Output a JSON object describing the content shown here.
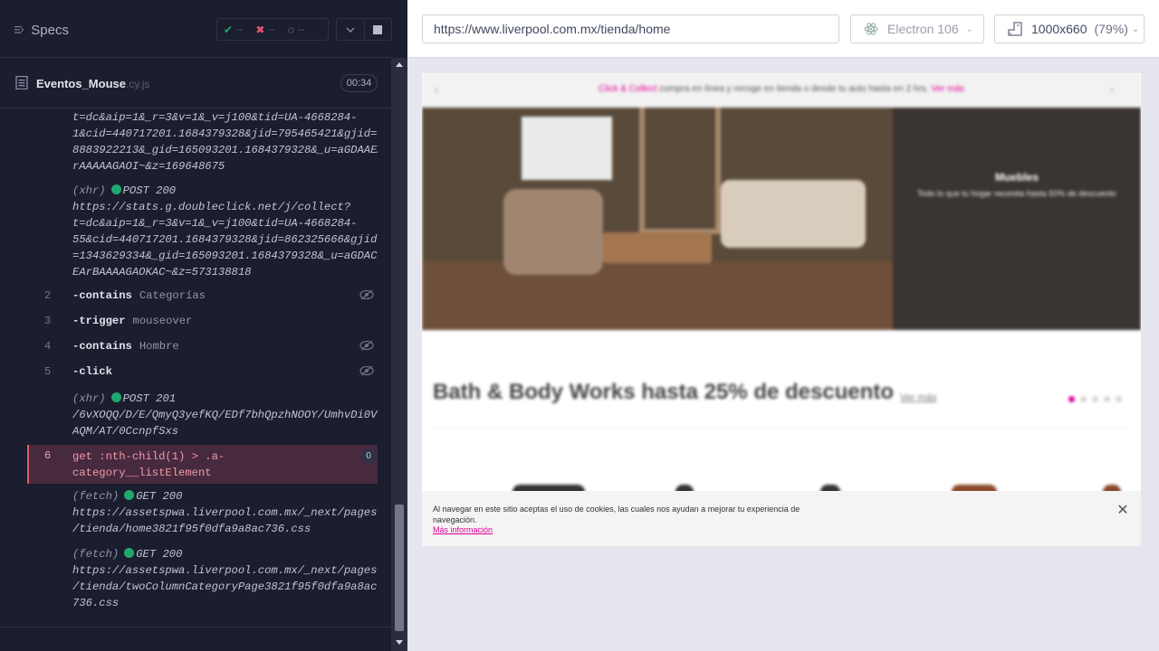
{
  "reporter": {
    "header": {
      "specs_label": "Specs",
      "stats": {
        "passed": "--",
        "failed": "--",
        "pending": "--"
      }
    },
    "runnable": {
      "spec_name": "Eventos_Mouse",
      "spec_ext": ".cy.js",
      "duration": "00:34"
    },
    "log": {
      "xhr_top_lines": [
        "t=dc&aip=1&_r=3&v=1&_v=j100&tid=UA-4668284-",
        "1&cid=440717201.1684379328&jid=795465421&gjid=",
        "8883922213&_gid=165093201.1684379328&_u=aGDAAEA",
        "rAAAAAGAOI~&z=169648675"
      ],
      "xhr_2": {
        "kind": "(xhr)",
        "method": "POST 200",
        "lines": [
          "https://stats.g.doubleclick.net/j/collect?",
          "t=dc&aip=1&_r=3&v=1&_v=j100&tid=UA-4668284-",
          "55&cid=440717201.1684379328&jid=862325666&gjid",
          "=1343629334&_gid=165093201.1684379328&_u=aGDAC",
          "EArBAAAAGAOKAC~&z=573138818"
        ]
      },
      "commands": [
        {
          "num": "2",
          "name": "-contains",
          "arg": "Categorías"
        },
        {
          "num": "3",
          "name": "-trigger",
          "arg": "mouseover"
        },
        {
          "num": "4",
          "name": "-contains",
          "arg": "Hombre"
        },
        {
          "num": "5",
          "name": "-click",
          "arg": ""
        }
      ],
      "xhr_3": {
        "kind": "(xhr)",
        "method": "POST 201",
        "lines": [
          "/6vXOQQ/D/E/QmyQ3yefKQ/EDf7bhQpzhNOOY/UmhvDi0V",
          "AQM/AT/0CcnpfSxs"
        ]
      },
      "active": {
        "num": "6",
        "lines": [
          "get  :nth-child(1) > .a-",
          "category__listElement"
        ],
        "badge": "0"
      },
      "fetch_1": {
        "kind": "(fetch)",
        "method": "GET 200",
        "lines": [
          "https://assetspwa.liverpool.com.mx/_next/pages",
          "/tienda/home3821f95f0dfa9a8ac736.css"
        ]
      },
      "fetch_2": {
        "kind": "(fetch)",
        "method": "GET 200",
        "lines": [
          "https://assetspwa.liverpool.com.mx/_next/pages",
          "/tienda/twoColumnCategoryPage3821f95f0dfa9a8ac",
          "736.css"
        ]
      }
    }
  },
  "app": {
    "url": "https://www.liverpool.com.mx/tienda/home",
    "browser": "Electron 106",
    "viewport_size": "1000x660",
    "viewport_scale": "(79%)",
    "page": {
      "promo": {
        "highlight": "Click & Collect",
        "text": " compra en línea y recoge en tienda o desde tu auto hasta en 2 hrs. ",
        "link": "Ver más"
      },
      "hero_title": "Muebles",
      "hero_sub": "Todo lo que tu hogar necesita hasta 50% de descuento",
      "section_title": "Bath & Body Works hasta 25% de descuento",
      "section_link": "Ver más",
      "cookie_text": "Al navegar en este sitio aceptas el uso de cookies, las cuales nos ayudan a mejorar tu experiencia de navegación.",
      "cookie_link": "Más información"
    }
  },
  "colors": {
    "passed": "#1fa971",
    "failed": "#e45770",
    "brand_pink": "#e10098"
  }
}
